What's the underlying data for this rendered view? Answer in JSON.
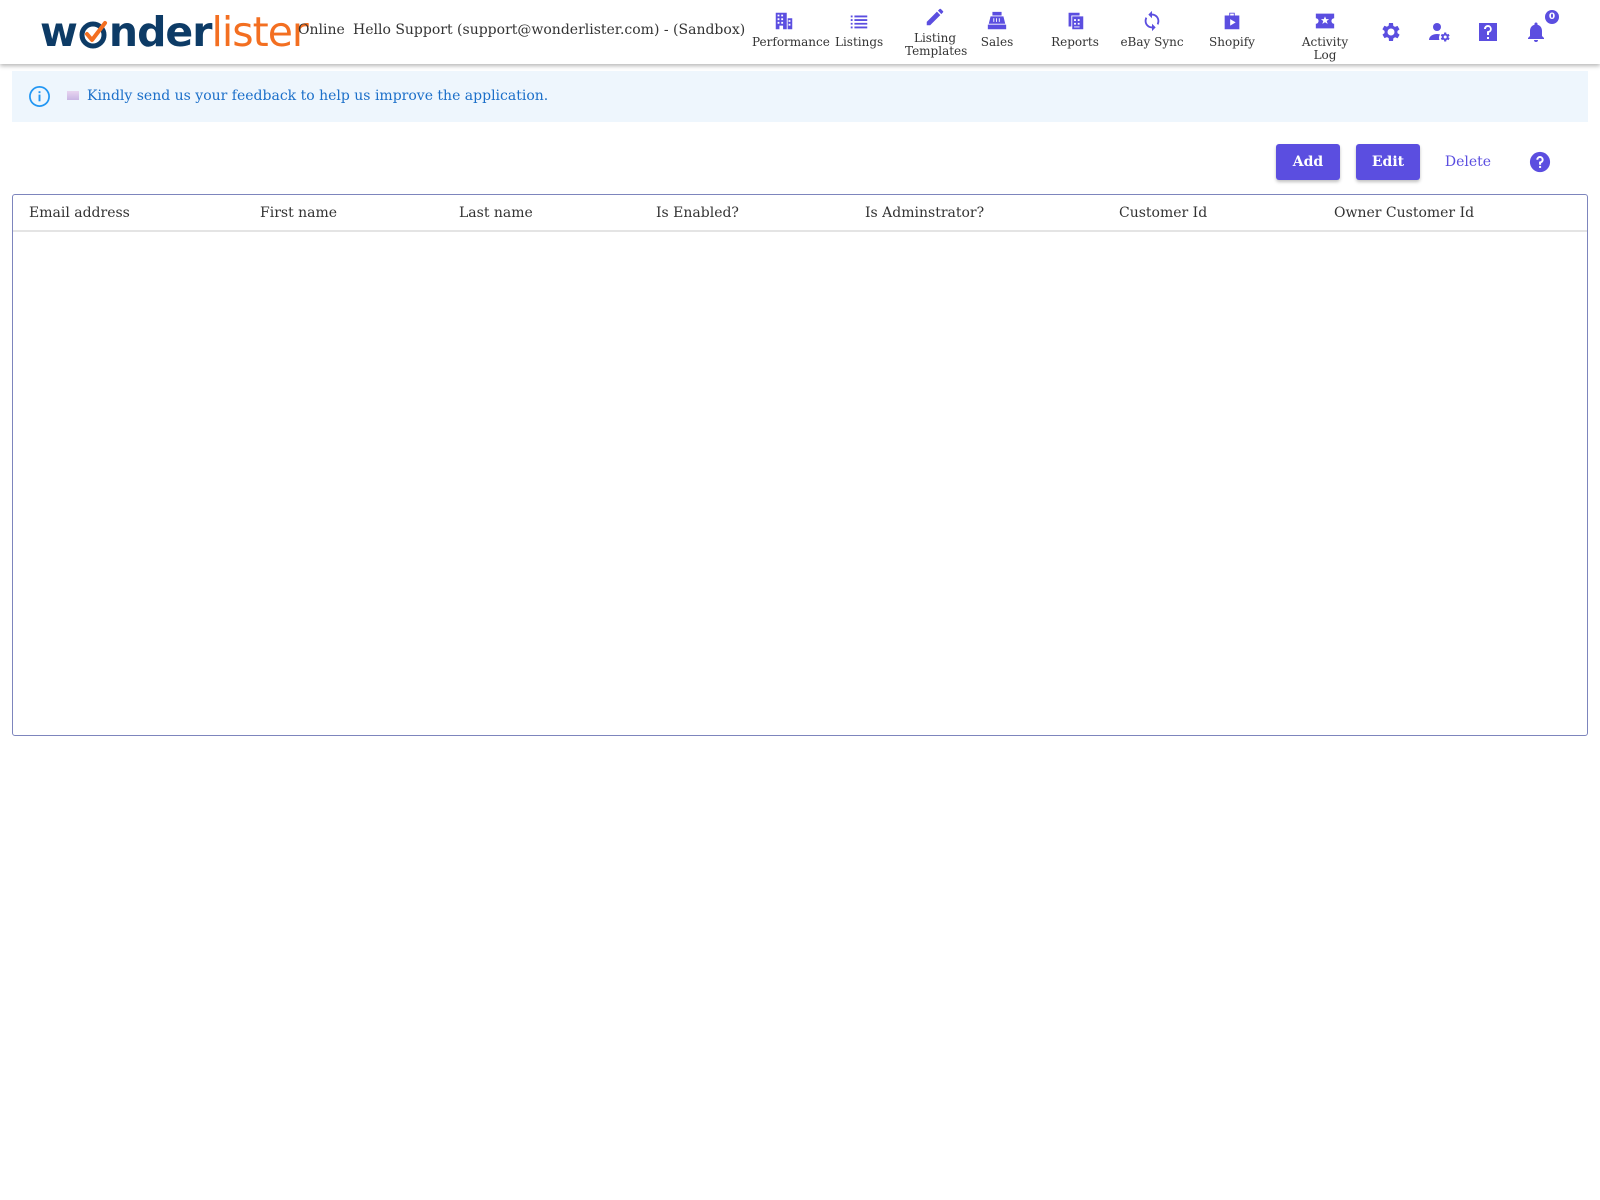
{
  "header": {
    "logo": {
      "part1": "w",
      "part2": "nder",
      "part3": "lister"
    },
    "status": "Online",
    "greeting": "Hello Support (support@wonderlister.com) - (Sandbox)",
    "nav": [
      {
        "label": "Performance",
        "icon": "building-icon"
      },
      {
        "label": "Listings",
        "icon": "list-icon"
      },
      {
        "label": "Listing Templates",
        "line1": "Listing",
        "line2": "Templates",
        "icon": "pencil-icon"
      },
      {
        "label": "Sales",
        "icon": "cash-register-icon"
      },
      {
        "label": "Reports",
        "icon": "reports-icon"
      },
      {
        "label": "eBay Sync",
        "icon": "sync-icon"
      },
      {
        "label": "Shopify",
        "icon": "shopify-bag-icon"
      },
      {
        "label": "Activity Log",
        "icon": "activity-log-icon"
      }
    ],
    "icons": [
      "gear-icon",
      "user-settings-icon",
      "help-icon",
      "bell-icon"
    ],
    "notification_count": "0"
  },
  "notice": {
    "message": "Kindly send us your feedback to help us improve the application."
  },
  "toolbar": {
    "add_label": "Add",
    "edit_label": "Edit",
    "delete_label": "Delete"
  },
  "table": {
    "columns": [
      "Email address",
      "First name",
      "Last name",
      "Is Enabled?",
      "Is Adminstrator?",
      "Customer Id",
      "Owner Customer Id"
    ],
    "rows": []
  },
  "colors": {
    "accent": "#5b4ee0",
    "logo_blue": "#0d3b66",
    "logo_orange": "#f36f21",
    "notice_bg": "#eef6fd",
    "notice_text": "#1b6fc9"
  }
}
